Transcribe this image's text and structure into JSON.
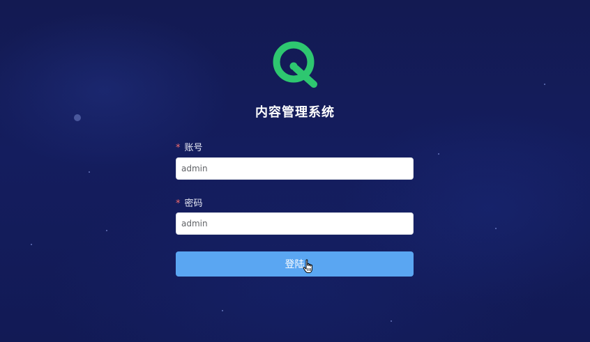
{
  "app": {
    "title": "内容管理系统"
  },
  "form": {
    "account": {
      "required_mark": "*",
      "label": "账号",
      "value": "admin"
    },
    "password": {
      "required_mark": "*",
      "label": "密码",
      "value": "admin"
    },
    "login_label": "登陆"
  },
  "colors": {
    "background": "#141d5e",
    "logo_green": "#2ec770",
    "button_blue": "#5aa6f2",
    "required_red": "#f56c6c"
  },
  "icons": {
    "logo": "q-logo-icon",
    "cursor": "hand-pointer-cursor-icon"
  }
}
